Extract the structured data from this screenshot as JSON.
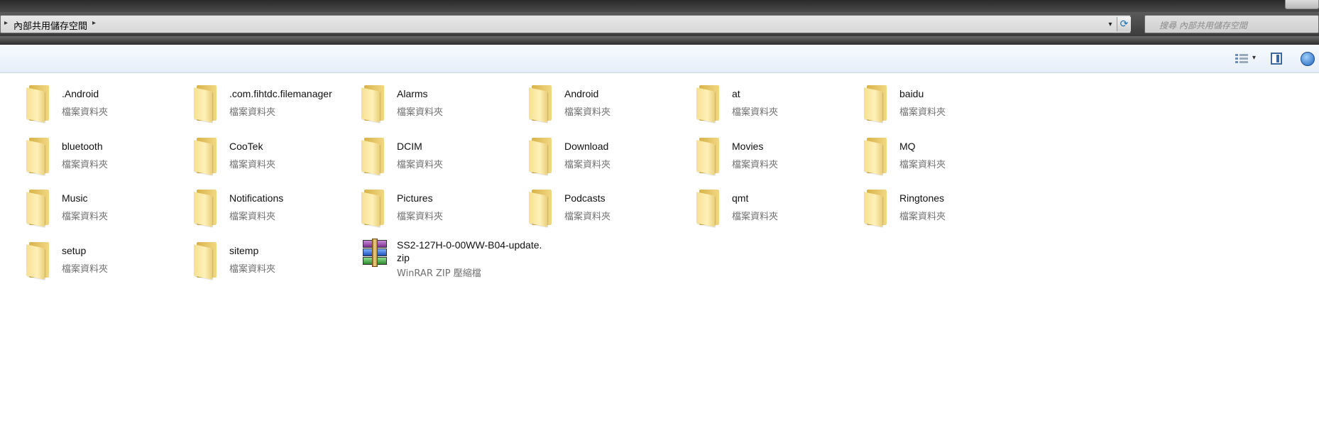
{
  "address": {
    "breadcrumb": "內部共用儲存空間",
    "search_placeholder": "搜尋 內部共用儲存空間"
  },
  "toolbar": {
    "view_icon": "view-options-icon",
    "pane_icon": "preview-pane-icon",
    "help_icon": "help-icon"
  },
  "items": [
    {
      "name": ".Android",
      "type": "檔案資料夾"
    },
    {
      "name": ".com.fihtdc.filemanager",
      "type": "檔案資料夾"
    },
    {
      "name": "Alarms",
      "type": "檔案資料夾"
    },
    {
      "name": "Android",
      "type": "檔案資料夾"
    },
    {
      "name": "at",
      "type": "檔案資料夾"
    },
    {
      "name": "baidu",
      "type": "檔案資料夾"
    },
    {
      "name": "bluetooth",
      "type": "檔案資料夾"
    },
    {
      "name": "CooTek",
      "type": "檔案資料夾"
    },
    {
      "name": "DCIM",
      "type": "檔案資料夾"
    },
    {
      "name": "Download",
      "type": "檔案資料夾"
    },
    {
      "name": "Movies",
      "type": "檔案資料夾"
    },
    {
      "name": "MQ",
      "type": "檔案資料夾"
    },
    {
      "name": "Music",
      "type": "檔案資料夾"
    },
    {
      "name": "Notifications",
      "type": "檔案資料夾"
    },
    {
      "name": "Pictures",
      "type": "檔案資料夾"
    },
    {
      "name": "Podcasts",
      "type": "檔案資料夾"
    },
    {
      "name": "qmt",
      "type": "檔案資料夾"
    },
    {
      "name": "Ringtones",
      "type": "檔案資料夾"
    },
    {
      "name": "setup",
      "type": "檔案資料夾"
    },
    {
      "name": "sitemp",
      "type": "檔案資料夾"
    }
  ],
  "archive": {
    "name_line1": "SS2-127H-0-00WW-B04-update.",
    "name_line2": "zip",
    "type": "WinRAR ZIP 壓縮檔"
  }
}
